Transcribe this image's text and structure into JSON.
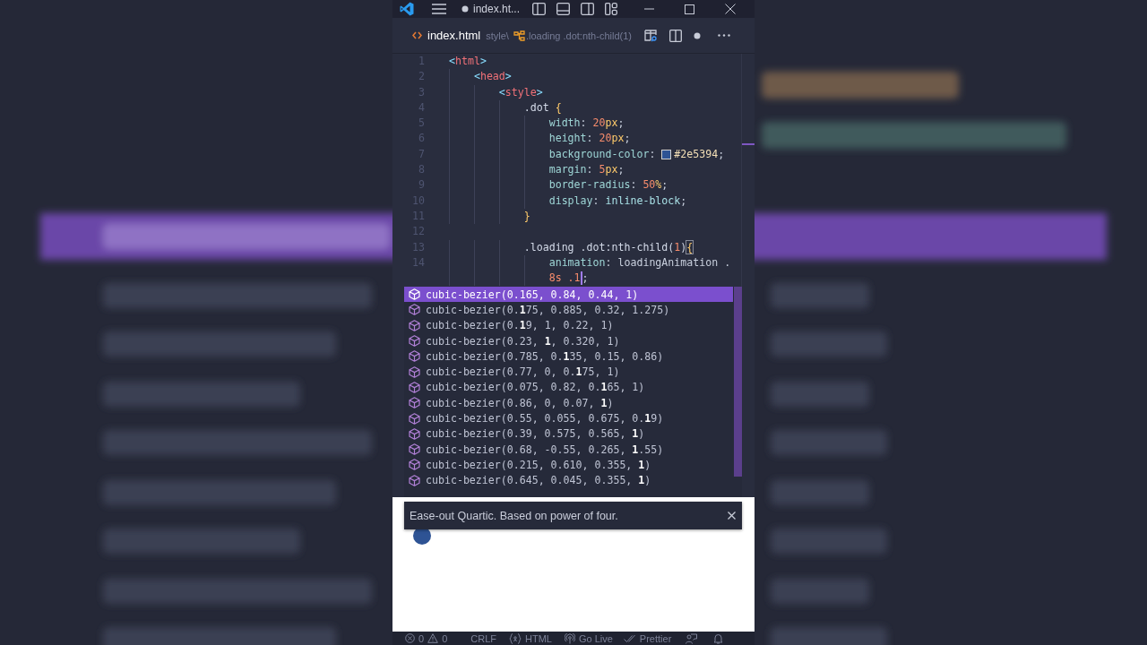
{
  "title_bar": {
    "title": "index.ht...",
    "dirty": true
  },
  "editor_tab": {
    "file": "index.html",
    "breadcrumb": [
      "style\\",
      ".loading .dot:nth-child(1)"
    ],
    "dirty": true
  },
  "code": {
    "lines": [
      {
        "number": "1",
        "tokens": [
          {
            "kind": "bracket",
            "text": "<"
          },
          {
            "kind": "tag",
            "text": "html"
          },
          {
            "kind": "bracket",
            "text": ">"
          }
        ]
      },
      {
        "number": "2",
        "tokens": [
          {
            "kind": "bracket",
            "text": "    <"
          },
          {
            "kind": "tag",
            "text": "head"
          },
          {
            "kind": "bracket",
            "text": ">"
          }
        ]
      },
      {
        "number": "3",
        "tokens": [
          {
            "kind": "bracket",
            "text": "        <"
          },
          {
            "kind": "tag",
            "text": "style"
          },
          {
            "kind": "bracket",
            "text": ">"
          }
        ]
      },
      {
        "number": "4",
        "tokens": [
          {
            "kind": "selector",
            "text": "            .dot "
          },
          {
            "kind": "brace",
            "text": "{"
          }
        ]
      },
      {
        "number": "5",
        "tokens": [
          {
            "kind": "prop",
            "text": "                width"
          },
          {
            "kind": "punct",
            "text": ": "
          },
          {
            "kind": "num",
            "text": "20"
          },
          {
            "kind": "unit",
            "text": "px"
          },
          {
            "kind": "punct",
            "text": ";"
          }
        ]
      },
      {
        "number": "6",
        "tokens": [
          {
            "kind": "prop",
            "text": "                height"
          },
          {
            "kind": "punct",
            "text": ": "
          },
          {
            "kind": "num",
            "text": "20"
          },
          {
            "kind": "unit",
            "text": "px"
          },
          {
            "kind": "punct",
            "text": ";"
          }
        ]
      },
      {
        "number": "7",
        "tokens": [
          {
            "kind": "prop",
            "text": "                background-color"
          },
          {
            "kind": "punct",
            "text": ": "
          },
          {
            "kind": "swatch",
            "color": "#2e5394"
          },
          {
            "kind": "hex",
            "text": "#2e5394"
          },
          {
            "kind": "punct",
            "text": ";"
          }
        ]
      },
      {
        "number": "8",
        "tokens": [
          {
            "kind": "prop",
            "text": "                margin"
          },
          {
            "kind": "punct",
            "text": ": "
          },
          {
            "kind": "num",
            "text": "5"
          },
          {
            "kind": "unit",
            "text": "px"
          },
          {
            "kind": "punct",
            "text": ";"
          }
        ]
      },
      {
        "number": "9",
        "tokens": [
          {
            "kind": "prop",
            "text": "                border-radius"
          },
          {
            "kind": "punct",
            "text": ": "
          },
          {
            "kind": "num",
            "text": "50"
          },
          {
            "kind": "unit",
            "text": "%"
          },
          {
            "kind": "punct",
            "text": ";"
          }
        ]
      },
      {
        "number": "10",
        "tokens": [
          {
            "kind": "prop",
            "text": "                display"
          },
          {
            "kind": "punct",
            "text": ": "
          },
          {
            "kind": "value",
            "text": "inline-block"
          },
          {
            "kind": "punct",
            "text": ";"
          }
        ]
      },
      {
        "number": "11",
        "tokens": [
          {
            "kind": "brace",
            "text": "            }"
          }
        ]
      },
      {
        "number": "12"
      },
      {
        "number": "13",
        "tokens": [
          {
            "kind": "selector",
            "text": "            .loading .dot:nth-child("
          },
          {
            "kind": "num",
            "text": "1"
          },
          {
            "kind": "selector",
            "text": ")"
          },
          {
            "kind": "brace-match",
            "text": "{"
          }
        ]
      },
      {
        "number": "14",
        "tokens": [
          {
            "kind": "prop",
            "text": "                animation"
          },
          {
            "kind": "punct",
            "text": ": "
          },
          {
            "kind": "plain",
            "text": "loadingAnimation ."
          }
        ]
      },
      {
        "tokens": [
          {
            "kind": "num",
            "text": "                8s .1"
          },
          {
            "kind": "cursor"
          },
          {
            "kind": "punct",
            "text": ";"
          }
        ]
      }
    ]
  },
  "suggestions": {
    "items": [
      {
        "label": "cubic-bezier(0.165, 0.84, 0.44, 1)",
        "selected": true
      },
      {
        "label": "cubic-bezier(0.**1**75, 0.885, 0.32, 1.275)",
        "selected": false
      },
      {
        "label": "cubic-bezier(0.**1**9, 1, 0.22, 1)",
        "selected": false
      },
      {
        "label": "cubic-bezier(0.23, **1**, 0.320, 1)",
        "selected": false
      },
      {
        "label": "cubic-bezier(0.785, 0.**1**35, 0.15, 0.86)",
        "selected": false
      },
      {
        "label": "cubic-bezier(0.77, 0, 0.**1**75, 1)",
        "selected": false
      },
      {
        "label": "cubic-bezier(0.075, 0.82, 0.**1**65, 1)",
        "selected": false
      },
      {
        "label": "cubic-bezier(0.86, 0, 0.07, **1**)",
        "selected": false
      },
      {
        "label": "cubic-bezier(0.55, 0.055, 0.675, 0.**1**9)",
        "selected": false
      },
      {
        "label": "cubic-bezier(0.39, 0.575, 0.565, **1**)",
        "selected": false
      },
      {
        "label": "cubic-bezier(0.68, -0.55, 0.265, **1**.55)",
        "selected": false
      },
      {
        "label": "cubic-bezier(0.215, 0.610, 0.355, **1**)",
        "selected": false
      },
      {
        "label": "cubic-bezier(0.645, 0.045, 0.355, **1**)",
        "selected": false
      }
    ]
  },
  "suggestion_detail": {
    "text": "Ease-out Quartic. Based on power of four."
  },
  "status_bar": {
    "errors": "0",
    "warnings": "0",
    "line_ending": "CRLF",
    "language": "HTML",
    "live": "Go Live",
    "formatter": "Prettier"
  }
}
